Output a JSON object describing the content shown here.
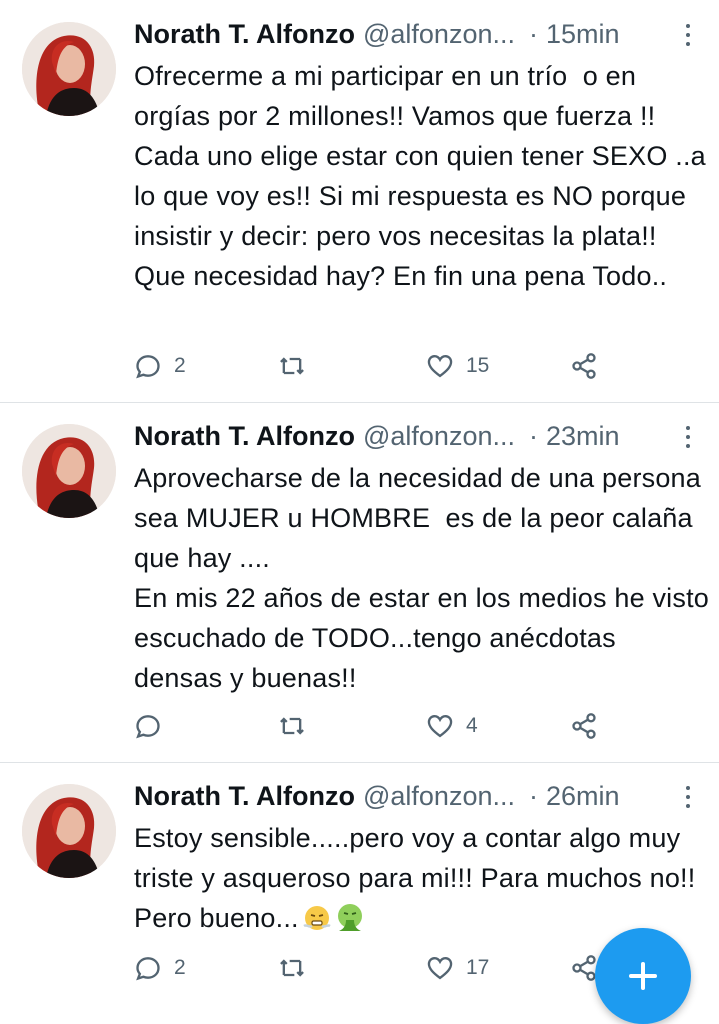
{
  "tweets": [
    {
      "name": "Norath T. Alfonzo",
      "handle": "@alfonzon...",
      "separator": "·",
      "time": "15min",
      "text": "Ofrecerme a mi participar en un trío  o en orgías por 2 millones!! Vamos que fuerza !! Cada uno elige estar con quien tener SEXO ..a lo que voy es!! Si mi respuesta es NO porque insistir y decir: pero vos necesitas la plata!! Que necesidad hay? En fin una pena Todo..",
      "replies": "2",
      "retweets": "",
      "likes": "15"
    },
    {
      "name": "Norath T. Alfonzo",
      "handle": "@alfonzon...",
      "separator": "·",
      "time": "23min",
      "text": "Aprovecharse de la necesidad de una persona sea MUJER u HOMBRE  es de la peor calaña que hay ....\nEn mis 22 años de estar en los medios he visto escuchado de TODO...tengo anécdotas densas y buenas!!",
      "replies": "",
      "retweets": "",
      "likes": "4"
    },
    {
      "name": "Norath T. Alfonzo",
      "handle": "@alfonzon...",
      "separator": "·",
      "time": "26min",
      "text": "Estoy sensible.....pero voy a contar algo muy triste y asqueroso para mi!!! Para muchos no!! Pero bueno...",
      "emojis": [
        "face-with-steam-icon",
        "vomiting-face-icon"
      ],
      "replies": "2",
      "retweets": "",
      "likes": "17"
    }
  ],
  "icons": {
    "reply": "reply-icon",
    "retweet": "retweet-icon",
    "like": "heart-icon",
    "share": "share-icon",
    "more": "more-vertical-icon",
    "compose": "plus-icon"
  },
  "colors": {
    "accent": "#1d9bf0",
    "text": "#0f1419",
    "secondary": "#536471",
    "divider": "#dfe3e6"
  }
}
